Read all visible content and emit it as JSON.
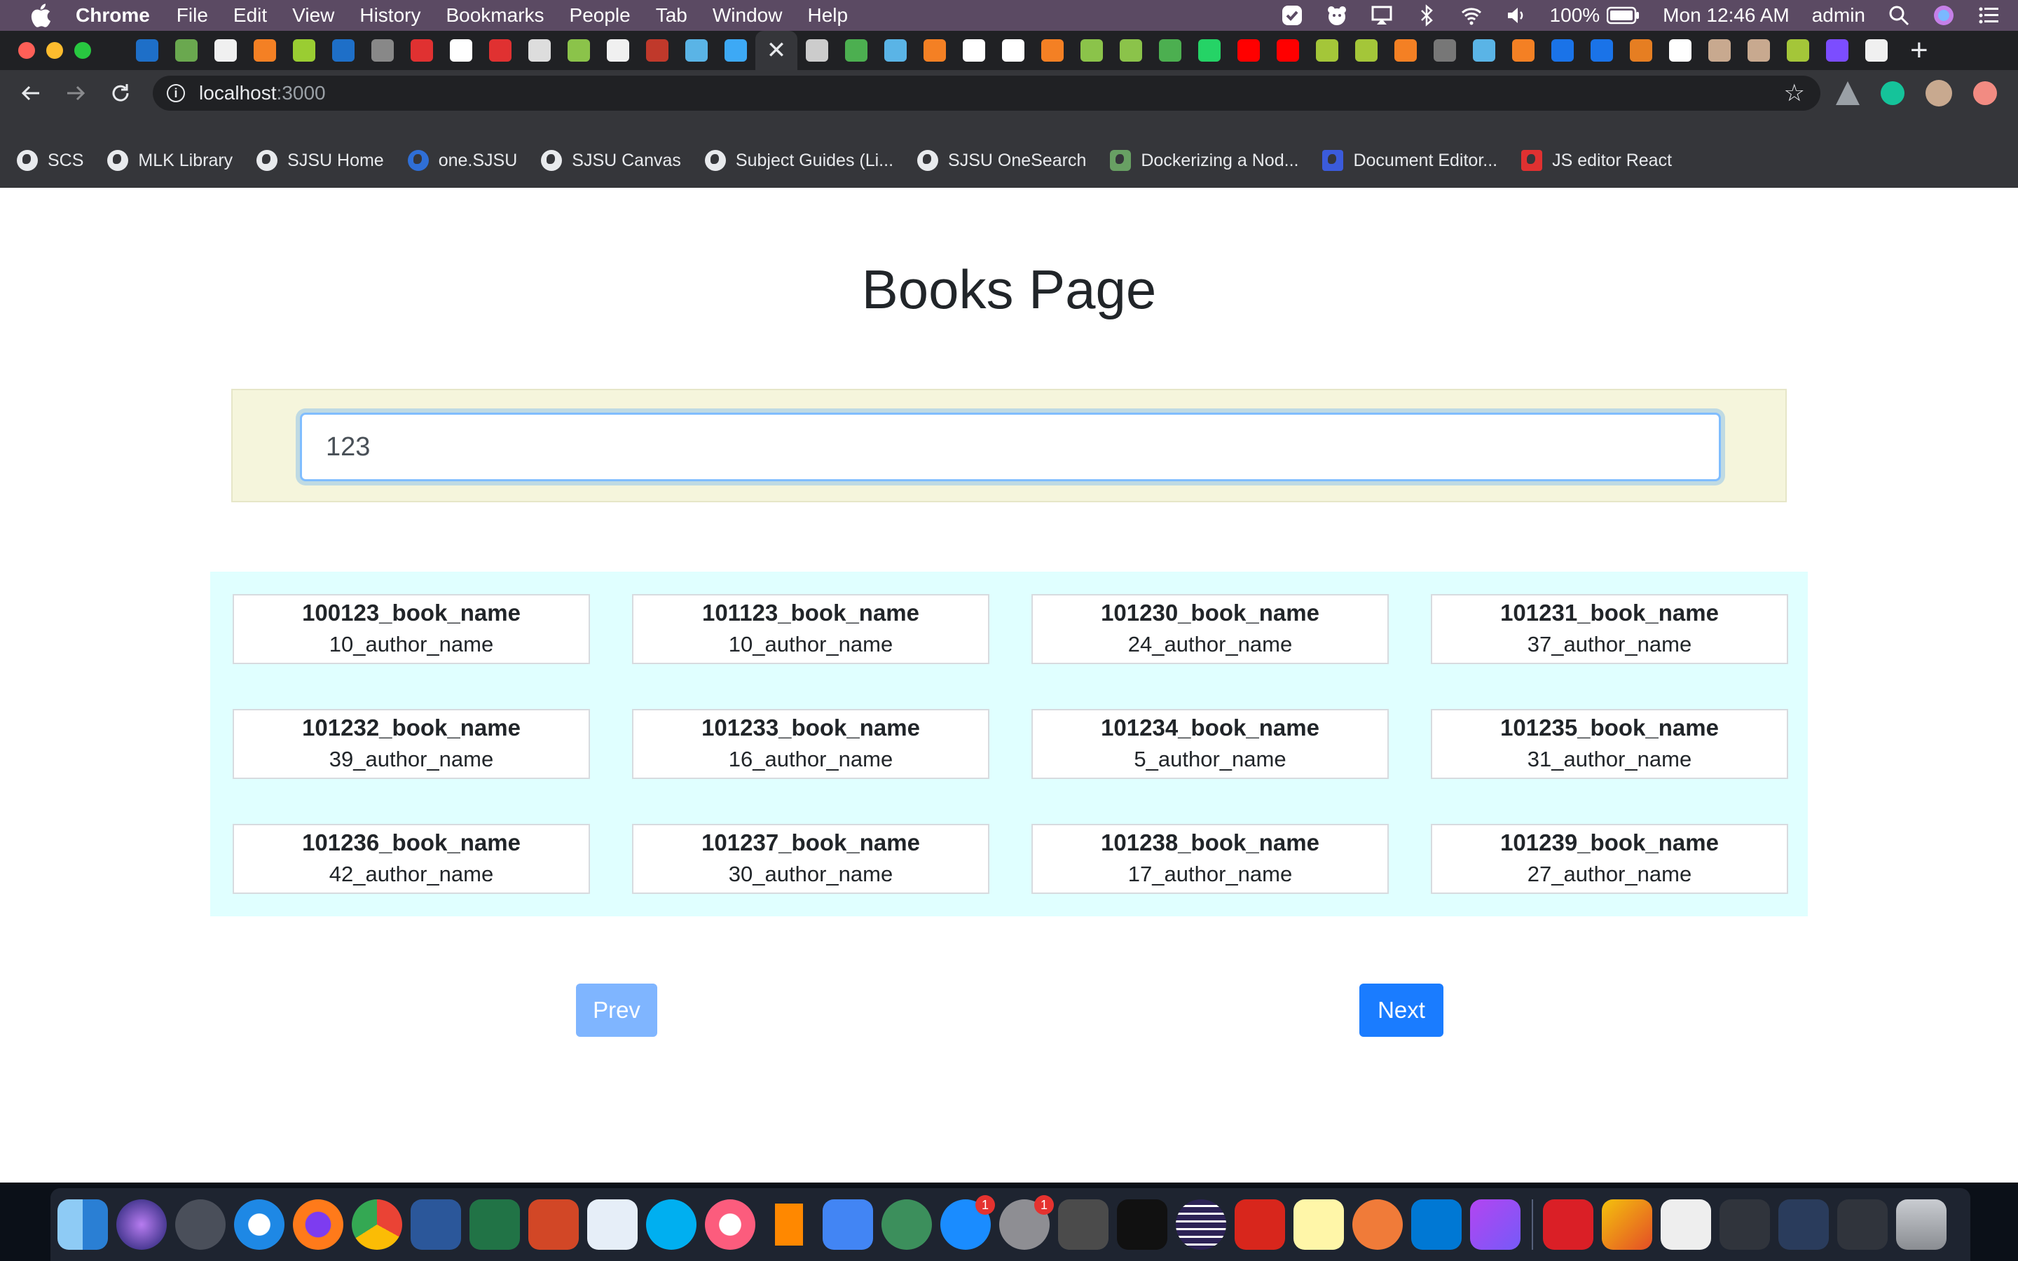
{
  "menubar": {
    "app": "Chrome",
    "items": [
      "File",
      "Edit",
      "View",
      "History",
      "Bookmarks",
      "People",
      "Tab",
      "Window",
      "Help"
    ],
    "battery": "100%",
    "clock": "Mon 12:46 AM",
    "user": "admin"
  },
  "omnibox": {
    "host": "localhost",
    "port": ":3000"
  },
  "bookmarks": [
    "SCS",
    "MLK Library",
    "SJSU Home",
    "one.SJSU",
    "SJSU Canvas",
    "Subject Guides (Li...",
    "SJSU OneSearch",
    "Dockerizing a Nod...",
    "Document Editor...",
    "JS editor React"
  ],
  "page": {
    "title": "Books Page",
    "search_value": "123",
    "books": [
      {
        "name": "100123_book_name",
        "author": "10_author_name"
      },
      {
        "name": "101123_book_name",
        "author": "10_author_name"
      },
      {
        "name": "101230_book_name",
        "author": "24_author_name"
      },
      {
        "name": "101231_book_name",
        "author": "37_author_name"
      },
      {
        "name": "101232_book_name",
        "author": "39_author_name"
      },
      {
        "name": "101233_book_name",
        "author": "16_author_name"
      },
      {
        "name": "101234_book_name",
        "author": "5_author_name"
      },
      {
        "name": "101235_book_name",
        "author": "31_author_name"
      },
      {
        "name": "101236_book_name",
        "author": "42_author_name"
      },
      {
        "name": "101237_book_name",
        "author": "30_author_name"
      },
      {
        "name": "101238_book_name",
        "author": "17_author_name"
      },
      {
        "name": "101239_book_name",
        "author": "27_author_name"
      }
    ],
    "prev_label": "Prev",
    "next_label": "Next"
  },
  "colors": {
    "search_bg": "#f5f5dc",
    "grid_bg": "#e0ffff",
    "next_button": "#1a7cff",
    "prev_button": "#7fb5ff"
  }
}
